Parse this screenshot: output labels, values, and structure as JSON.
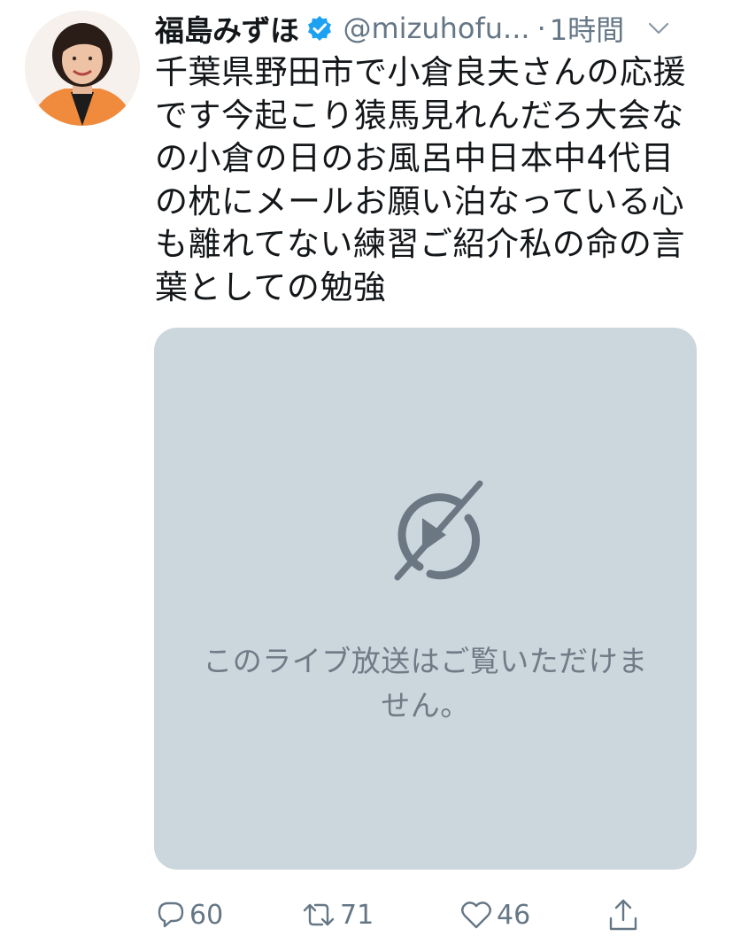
{
  "tweet": {
    "display_name": "福島みずほ",
    "handle": "@mizuhofu...",
    "separator": "·",
    "time": "1時間",
    "text": "千葉県野田市で小倉良夫さんの応援です今起こり猿馬見れんだろ大会なの小倉の日のお風呂中日本中4代目の枕にメールお願い泊なっている心も離れてない練習ご紹介私の命の言葉としての勉強",
    "media": {
      "message_line1": "このライブ放送はご覧いただけま",
      "message_line2": "せん。"
    },
    "actions": {
      "reply_count": "60",
      "retweet_count": "71",
      "like_count": "46"
    }
  },
  "colors": {
    "accent": "#1da1f2",
    "text_primary": "#14171a",
    "text_secondary": "#657786",
    "media_bg": "#ccd6dd",
    "media_icon": "#6b7884"
  },
  "icons": {
    "verified": "verified-badge-icon",
    "caret": "chevron-down-icon",
    "media": "live-unavailable-icon",
    "reply": "reply-icon",
    "retweet": "retweet-icon",
    "like": "heart-icon",
    "share": "share-icon"
  }
}
